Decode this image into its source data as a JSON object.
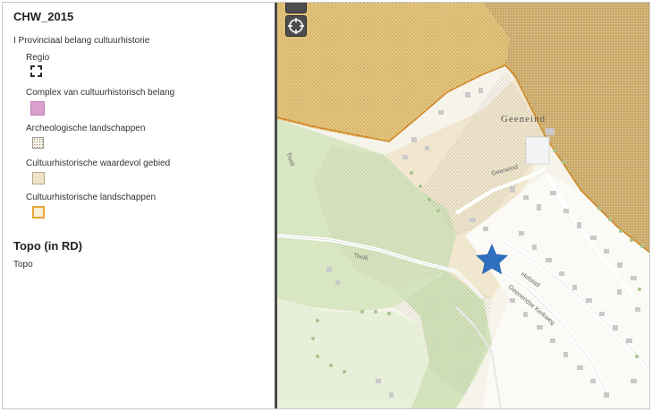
{
  "legend": {
    "layer1_title": "CHW_2015",
    "group_label": "I Provinciaal belang cultuurhistorie",
    "items": [
      {
        "label": "Regio",
        "swatch": "dashed-outline"
      },
      {
        "label": "Complex van cultuurhistorisch belang",
        "swatch": "pink-fill"
      },
      {
        "label": "Archeologische landschappen",
        "swatch": "dotted-fill"
      },
      {
        "label": "Cultuurhistorische waardevol gebied",
        "swatch": "beige-fill"
      },
      {
        "label": "Cultuurhistorische landschappen",
        "swatch": "orange-outline"
      }
    ],
    "layer2_title": "Topo (in RD)",
    "layer2_sub": "Topo"
  },
  "map": {
    "labels": {
      "place": "Geeneind",
      "street1": "Geeneind",
      "street2": "Tivoli",
      "street3": "Tivoli",
      "street4": "Hofstad",
      "street5": "Geenendse Kerkweg"
    },
    "marker_icon": "star-icon",
    "controls": [
      "zoom-control-icon",
      "locate-icon"
    ]
  },
  "colors": {
    "pink": "#d9a0cf",
    "beige": "#efe2c8",
    "orange": "#e8a838",
    "regio": "#2b2b2b",
    "marker": "#2e6fbf",
    "green": "#d8e8c4",
    "boundary": "#d08a2a"
  }
}
